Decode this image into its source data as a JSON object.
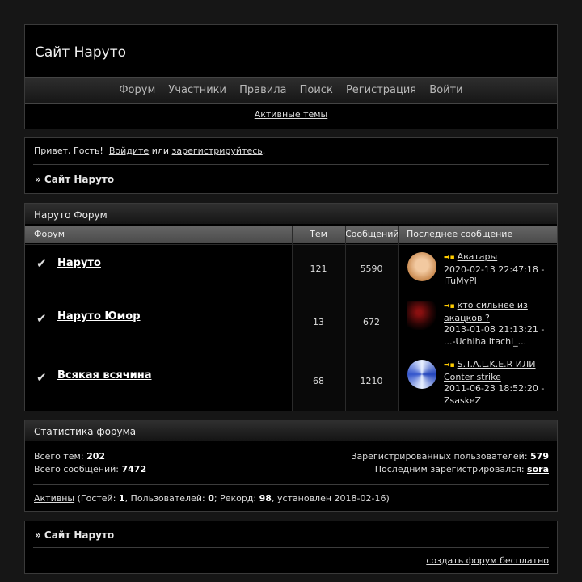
{
  "site": {
    "title": "Сайт Наруто"
  },
  "nav": {
    "items": [
      "Форум",
      "Участники",
      "Правила",
      "Поиск",
      "Регистрация",
      "Войти"
    ],
    "active_topics": "Активные темы"
  },
  "welcome": {
    "greeting": "Привет, Гость!",
    "login": "Войдите",
    "or": "или",
    "register": "зарегистрируйтесь",
    "dot": ".",
    "breadcrumb": "» Сайт Наруто"
  },
  "forum": {
    "category": "Наруто Форум",
    "headers": {
      "forum": "Форум",
      "topics": "Тем",
      "posts": "Сообщений",
      "last": "Последнее сообщение"
    },
    "rows": [
      {
        "name": "Наруто",
        "topics": "121",
        "posts": "5590",
        "last_title": "Аватары",
        "last_date": "2020-02-13 22:47:18 -",
        "last_user": "lTuMyPl",
        "avatar_colors": [
          "#f2c9a0",
          "#c98a50"
        ]
      },
      {
        "name": "Наруто Юмор",
        "topics": "13",
        "posts": "672",
        "last_title": "кто сильнее из акацков ?",
        "last_date": "2013-01-08 21:13:21 -",
        "last_user": "...-Uchiha Itachi_...",
        "avatar_colors": [
          "#2a0505",
          "#8a1010"
        ]
      },
      {
        "name": "Всякая всячина",
        "topics": "68",
        "posts": "1210",
        "last_title": "S.T.A.L.K.E.R ИЛИ Conter strike",
        "last_date": "2011-06-23 18:52:20 -",
        "last_user": "ZsaskeZ",
        "avatar_colors": [
          "#e8f0ff",
          "#2244bb"
        ]
      }
    ]
  },
  "stats": {
    "title": "Статистика форума",
    "topics_label": "Всего тем:",
    "topics_value": "202",
    "posts_label": "Всего сообщений:",
    "posts_value": "7472",
    "registered_label": "Зарегистрированных пользователей:",
    "registered_value": "579",
    "last_reg_label": "Последним зарегистрировался:",
    "last_reg_value": "sora",
    "active_link": "Активны",
    "guests_label": "(Гостей:",
    "guests_value": "1",
    "users_label": ", Пользователей:",
    "users_value": "0",
    "record_label": "; Рекорд:",
    "record_value": "98",
    "record_tail": ", установлен 2018-02-16)"
  },
  "footer": {
    "breadcrumb": "» Сайт Наруто",
    "create_link": "создать форум бесплатно"
  }
}
